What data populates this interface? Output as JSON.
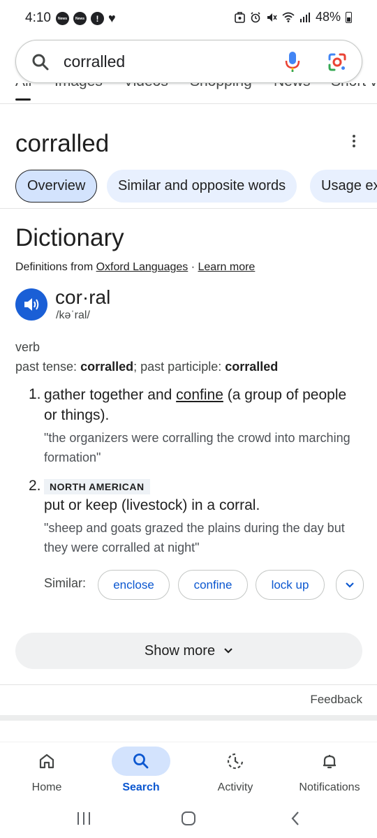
{
  "status_bar": {
    "time": "4:10",
    "left_icons": [
      "news-icon",
      "news-icon",
      "alert-icon",
      "heart-icon"
    ],
    "news_label": "News",
    "alert_glyph": "!",
    "battery": "48%",
    "right_icons": [
      "nfc-icon",
      "alarm-icon",
      "mute-icon",
      "wifi-icon",
      "signal-icon",
      "battery-icon"
    ]
  },
  "search": {
    "query": "corralled",
    "icons": [
      "search-icon",
      "mic-icon",
      "lens-icon"
    ]
  },
  "tabs": [
    "All",
    "Images",
    "Videos",
    "Shopping",
    "News",
    "Short v"
  ],
  "word_header": {
    "title": "corralled"
  },
  "chips": [
    "Overview",
    "Similar and opposite words",
    "Usage ex"
  ],
  "dictionary": {
    "heading": "Dictionary",
    "source_prefix": "Definitions from",
    "source_link": "Oxford Languages",
    "separator": "·",
    "learn_more": "Learn more",
    "headword": "cor·ral",
    "phonetic": "/kəˈral/",
    "part_of_speech": "verb",
    "past_tense_label": "past tense:",
    "past_tense_value": "corralled",
    "past_participle_label": "past participle:",
    "past_participle_value": "corralled",
    "senses": [
      {
        "number": "1.",
        "definition_pre": "gather together and ",
        "definition_link": "confine",
        "definition_post": " (a group of people or things).",
        "example": "\"the organizers were corralling the crowd into marching formation\""
      },
      {
        "number": "2.",
        "label": "NORTH AMERICAN",
        "definition": "put or keep (livestock) in a corral.",
        "example": "\"sheep and goats grazed the plains during the day but they were corralled at night\""
      }
    ],
    "similar_label": "Similar:",
    "similar_words": [
      "enclose",
      "confine",
      "lock up"
    ],
    "show_more": "Show more"
  },
  "feedback": "Feedback",
  "bottom_nav": [
    {
      "label": "Home",
      "icon": "home-icon",
      "active": false
    },
    {
      "label": "Search",
      "icon": "search-icon",
      "active": true
    },
    {
      "label": "Activity",
      "icon": "activity-icon",
      "active": false
    },
    {
      "label": "Notifications",
      "icon": "bell-icon",
      "active": false
    }
  ],
  "system_nav": [
    "recents-icon",
    "home-button-icon",
    "back-icon"
  ],
  "colors": {
    "accent_blue": "#0b57d0",
    "chip_bg": "#e8f0fe",
    "speaker_bg": "#1a5fd6"
  }
}
